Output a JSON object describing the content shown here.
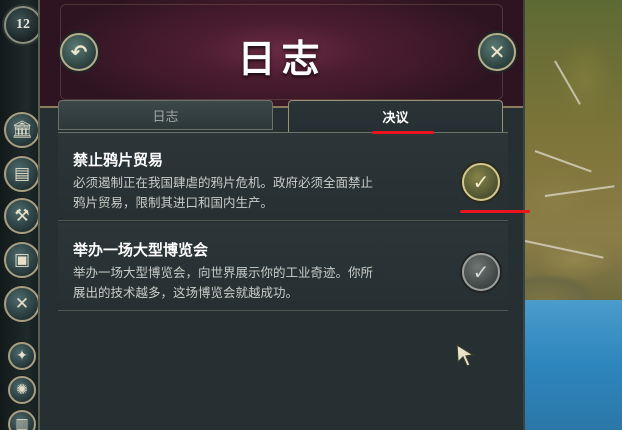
{
  "sidebar": {
    "turn_number": "12",
    "buttons": [
      {
        "name": "parliament-icon",
        "glyph": "🏛"
      },
      {
        "name": "scroll-icon",
        "glyph": "▤"
      },
      {
        "name": "factory-icon",
        "glyph": "⚒"
      },
      {
        "name": "crate-icon",
        "glyph": "▣"
      },
      {
        "name": "crossed-swords-icon",
        "glyph": "✕"
      },
      {
        "name": "compass-icon",
        "glyph": "✦"
      },
      {
        "name": "lightbulb-icon",
        "glyph": "✺"
      },
      {
        "name": "book-icon",
        "glyph": "▥"
      }
    ]
  },
  "dialog": {
    "title": "日志",
    "back_glyph": "↶",
    "close_glyph": "✕",
    "tabs": [
      {
        "label": "日志",
        "active": false
      },
      {
        "label": "决议",
        "active": true
      }
    ],
    "decisions": [
      {
        "title": "禁止鸦片贸易",
        "desc_line1": "必须遏制正在我国肆虐的鸦片危机。政府必须全面禁止",
        "desc_line2": "鸦片贸易，限制其进口和国内生产。",
        "check_glyph": "✓",
        "enabled": true
      },
      {
        "title": "举办一场大型博览会",
        "desc_line1": "举办一场大型博览会，向世界展示你的工业奇迹。你所",
        "desc_line2": "展出的技术越多，这场博览会就越成功。",
        "check_glyph": "✓",
        "enabled": false
      }
    ]
  },
  "colors": {
    "banner": "#4a1c30",
    "panel": "#263033",
    "annotation_red": "#e8141e",
    "enabled_button": "#86844a",
    "disabled_button": "#6f7674"
  }
}
